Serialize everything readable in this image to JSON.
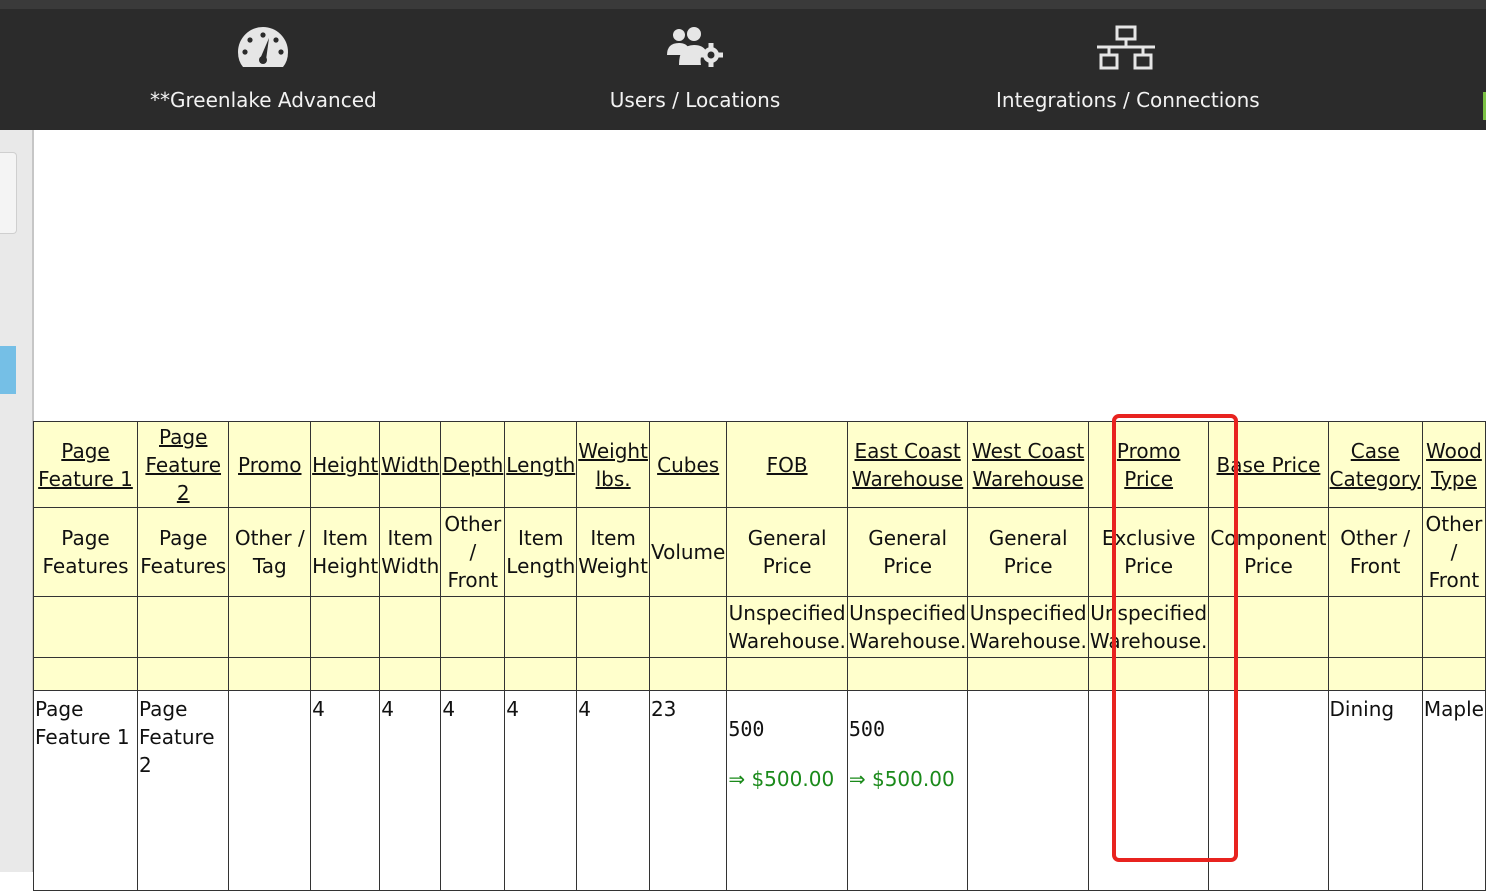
{
  "nav": {
    "items": [
      {
        "label": "**Greenlake Advanced",
        "icon": "speedometer-icon"
      },
      {
        "label": "Users / Locations",
        "icon": "users-gear-icon"
      },
      {
        "label": "Integrations / Connections",
        "icon": "network-icon"
      }
    ]
  },
  "table": {
    "header_row1": [
      "Page Feature 1",
      "Page Feature 2",
      "Promo",
      "Height",
      "Width",
      "Depth",
      "Length",
      "Weight lbs.",
      "Cubes",
      "FOB",
      "East Coast Warehouse",
      "West Coast Warehouse",
      "Promo Price",
      "Base Price",
      "Case Category",
      "Wood Type"
    ],
    "header_row2": [
      "Page Features",
      "Page Features",
      "Other / Tag",
      "Item Height",
      "Item Width",
      "Other / Front",
      "Item Length",
      "Item Weight",
      "Volume",
      "General Price",
      "General Price",
      "General Price",
      "Exclusive Price",
      "Component Price",
      "Other / Front",
      "Other / Front"
    ],
    "header_row3": [
      "",
      "",
      "",
      "",
      "",
      "",
      "",
      "",
      "",
      "Unspecified Warehouse.",
      "Unspecified Warehouse.",
      "Unspecified Warehouse.",
      "Unspecified Warehouse.",
      "",
      "",
      ""
    ],
    "data_row": {
      "page_feature_1": "Page Feature 1",
      "page_feature_2": "Page Feature 2",
      "promo": "",
      "height": "4",
      "width": "4",
      "depth": "4",
      "length": "4",
      "weight": "4",
      "cubes": "23",
      "fob_value": "500",
      "fob_converted": "⇒ $500.00",
      "east_value": "500",
      "east_converted": "⇒ $500.00",
      "west_value": "",
      "promo_price": "",
      "base_price": "",
      "case_category": "Dining",
      "wood_type": "Maple"
    }
  },
  "colors": {
    "topbar": "#2b2b2b",
    "header_cell": "#ffffcc",
    "highlight": "#e8231f",
    "converted_price": "#1a8a1a",
    "sidebar_tab": "#75bfe6"
  }
}
